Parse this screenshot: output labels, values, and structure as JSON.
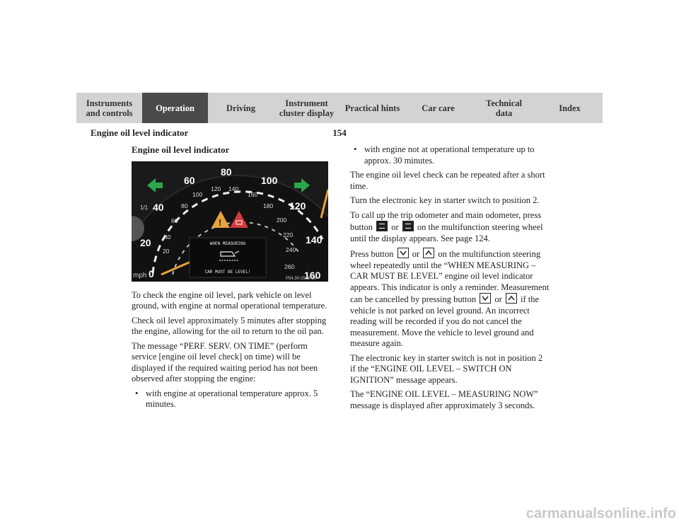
{
  "tabs": [
    {
      "label": "Instruments\nand controls",
      "active": false
    },
    {
      "label": "Operation",
      "active": true
    },
    {
      "label": "Driving",
      "active": false
    },
    {
      "label": "Instrument\ncluster display",
      "active": false
    },
    {
      "label": "Practical hints",
      "active": false
    },
    {
      "label": "Car care",
      "active": false
    },
    {
      "label": "Technical\ndata",
      "active": false
    },
    {
      "label": "Index",
      "active": false
    }
  ],
  "header": {
    "section": "Engine oil level indicator",
    "page": "154"
  },
  "left": {
    "heading": "Engine oil level indicator",
    "figure": {
      "speed_labels_outer": [
        "20",
        "40",
        "60",
        "80",
        "100",
        "120",
        "140",
        "160"
      ],
      "speed_labels_inner": [
        "20",
        "40",
        "60",
        "80",
        "100",
        "120",
        "140",
        "160",
        "180",
        "200",
        "220",
        "240",
        "260"
      ],
      "unit_mph": "mph",
      "unit_kmh": "km/h",
      "zero": "0",
      "fuel_label": "1/1",
      "display_top": "WHEN MEASURING",
      "display_bottom": "CAR MUST BE LEVEL!",
      "code": "P54.30-2522-26"
    },
    "p1": "To check the engine oil level, park vehicle on level ground, with engine at normal operational temperature.",
    "p2": "Check oil level approximately 5 minutes after stopping the engine, allowing for the oil to return to the oil pan.",
    "p3": "The message “PERF. SERV. ON TIME” (perform service [engine oil level check] on time) will be displayed if the required waiting period has not been observed after stopping the engine:",
    "b1": "with engine at operational temperature approx. 5 minutes."
  },
  "right": {
    "b2": "with engine not at operational temperature up to approx. 30 minutes.",
    "p4": "The engine oil level check can be repeated after a short time.",
    "p5": "Turn the electronic key in starter switch to position 2.",
    "p6a": "To call up the trip odometer and main odometer, press button",
    "p6b": "or",
    "p6c": "on the multifunction steering wheel until the display appears. See page 124.",
    "p7a": "Press button",
    "p7b": "or",
    "p7c": "on the multifunction steering wheel repeatedly until the “WHEN MEASURING – CAR MUST BE LEVEL” engine oil level indicator appears. This indicator is only a reminder. Measurement can be cancelled by pressing button",
    "p7d": "or",
    "p7e": "if the vehicle is not parked on level ground. An incorrect reading will be recorded if you do not cancel the measurement. Move the vehicle to level ground and measure again.",
    "p8": "The electronic key in starter switch is not in position 2 if the “ENGINE OIL LEVEL – SWITCH ON IGNITION” message appears.",
    "p9": "The “ENGINE OIL LEVEL – MEASURING NOW” message is displayed after approximately 3 seconds."
  },
  "watermark": "carmanualsonline.info"
}
